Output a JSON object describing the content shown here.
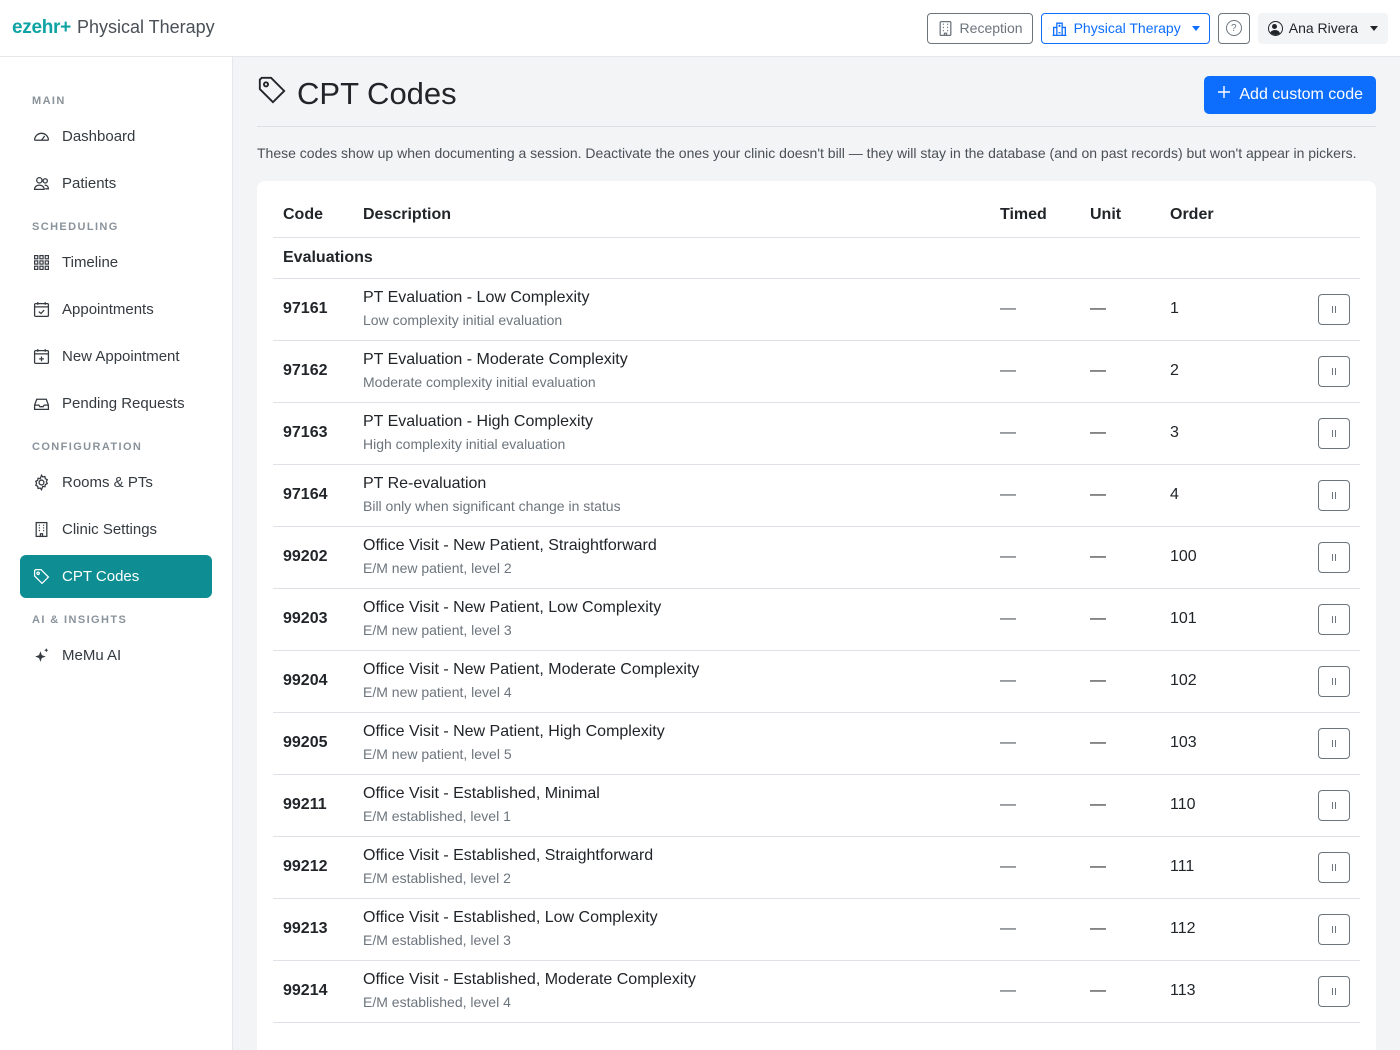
{
  "brand": {
    "logo": "ezehr+",
    "name": "Physical Therapy"
  },
  "topbar": {
    "reception": "Reception",
    "department": "Physical Therapy",
    "user": "Ana Rivera"
  },
  "sidebar": {
    "sections": {
      "main": "MAIN",
      "scheduling": "SCHEDULING",
      "configuration": "CONFIGURATION",
      "ai": "AI & INSIGHTS"
    },
    "items": {
      "dashboard": "Dashboard",
      "patients": "Patients",
      "timeline": "Timeline",
      "appointments": "Appointments",
      "new_appointment": "New Appointment",
      "pending_requests": "Pending Requests",
      "rooms": "Rooms & PTs",
      "clinic_settings": "Clinic Settings",
      "cpt_codes": "CPT Codes",
      "memu": "MeMu AI"
    }
  },
  "page": {
    "title": "CPT Codes",
    "add_button": "Add custom code",
    "intro": "These codes show up when documenting a session. Deactivate the ones your clinic doesn't bill — they will stay in the database (and on past records) but won't appear in pickers."
  },
  "table": {
    "headers": {
      "code": "Code",
      "description": "Description",
      "timed": "Timed",
      "unit": "Unit",
      "order": "Order"
    },
    "group": "Evaluations",
    "rows": [
      {
        "code": "97161",
        "title": "PT Evaluation - Low Complexity",
        "sub": "Low complexity initial evaluation",
        "timed": "—",
        "unit": "—",
        "order": "1"
      },
      {
        "code": "97162",
        "title": "PT Evaluation - Moderate Complexity",
        "sub": "Moderate complexity initial evaluation",
        "timed": "—",
        "unit": "—",
        "order": "2"
      },
      {
        "code": "97163",
        "title": "PT Evaluation - High Complexity",
        "sub": "High complexity initial evaluation",
        "timed": "—",
        "unit": "—",
        "order": "3"
      },
      {
        "code": "97164",
        "title": "PT Re-evaluation",
        "sub": "Bill only when significant change in status",
        "timed": "—",
        "unit": "—",
        "order": "4"
      },
      {
        "code": "99202",
        "title": "Office Visit - New Patient, Straightforward",
        "sub": "E/M new patient, level 2",
        "timed": "—",
        "unit": "—",
        "order": "100"
      },
      {
        "code": "99203",
        "title": "Office Visit - New Patient, Low Complexity",
        "sub": "E/M new patient, level 3",
        "timed": "—",
        "unit": "—",
        "order": "101"
      },
      {
        "code": "99204",
        "title": "Office Visit - New Patient, Moderate Complexity",
        "sub": "E/M new patient, level 4",
        "timed": "—",
        "unit": "—",
        "order": "102"
      },
      {
        "code": "99205",
        "title": "Office Visit - New Patient, High Complexity",
        "sub": "E/M new patient, level 5",
        "timed": "—",
        "unit": "—",
        "order": "103"
      },
      {
        "code": "99211",
        "title": "Office Visit - Established, Minimal",
        "sub": "E/M established, level 1",
        "timed": "—",
        "unit": "—",
        "order": "110"
      },
      {
        "code": "99212",
        "title": "Office Visit - Established, Straightforward",
        "sub": "E/M established, level 2",
        "timed": "—",
        "unit": "—",
        "order": "111"
      },
      {
        "code": "99213",
        "title": "Office Visit - Established, Low Complexity",
        "sub": "E/M established, level 3",
        "timed": "—",
        "unit": "—",
        "order": "112"
      },
      {
        "code": "99214",
        "title": "Office Visit - Established, Moderate Complexity",
        "sub": "E/M established, level 4",
        "timed": "—",
        "unit": "—",
        "order": "113"
      }
    ]
  },
  "colors": {
    "brand": "#0fa3a3",
    "active_nav": "#0e8e93",
    "primary": "#0d6efd"
  }
}
